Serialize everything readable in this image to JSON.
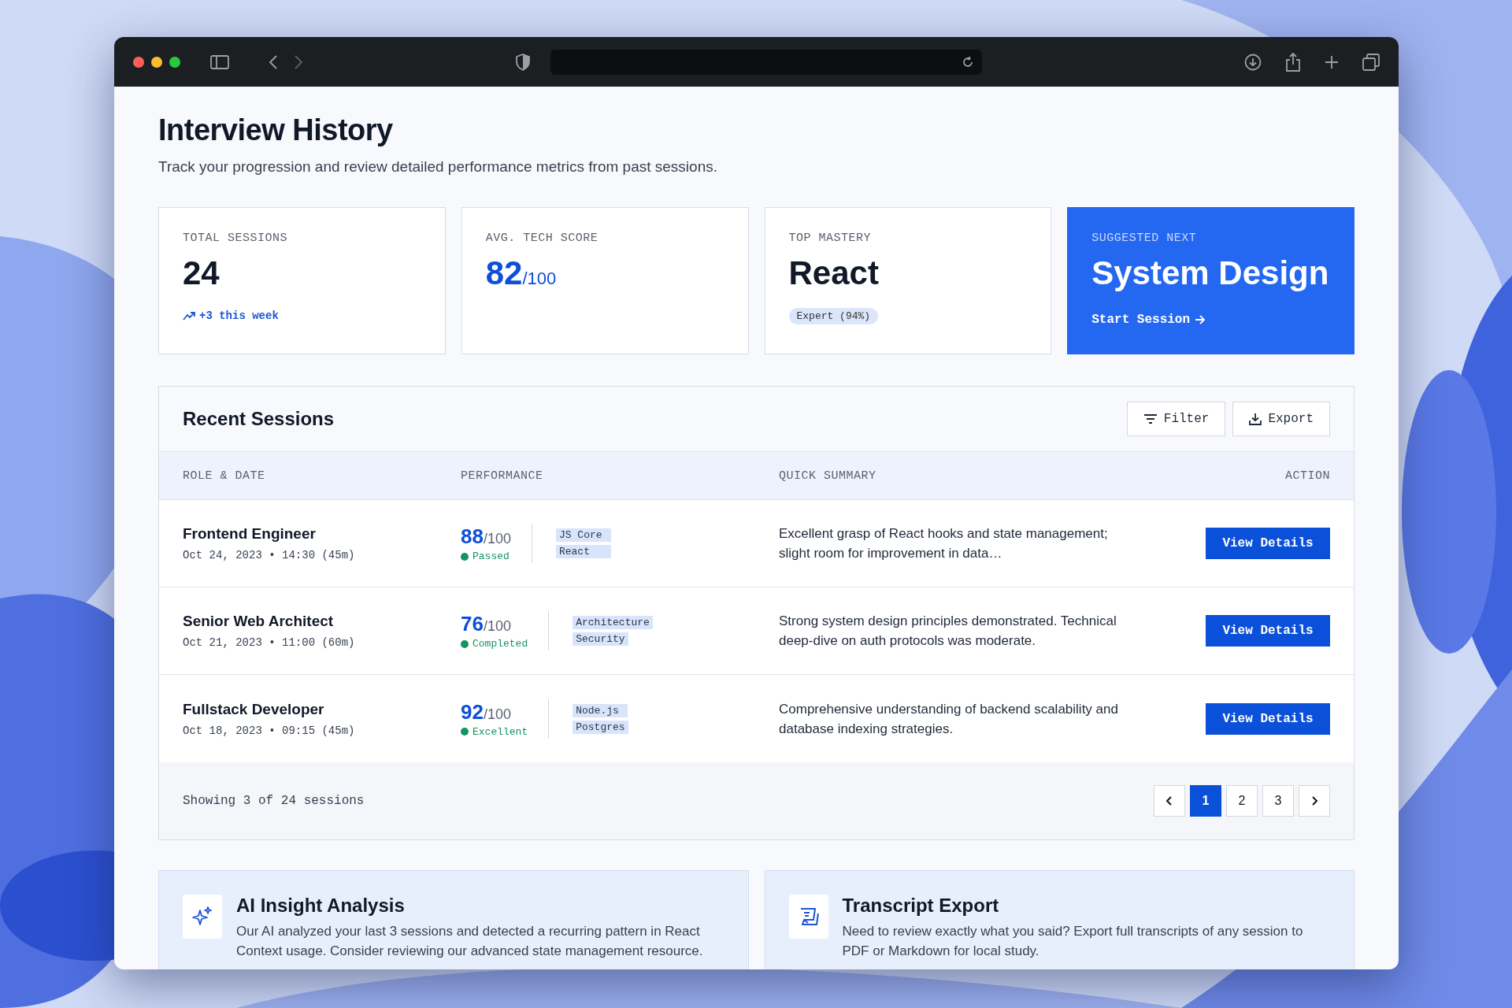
{
  "page": {
    "title": "Interview History",
    "subtitle": "Track your progression and review detailed performance metrics from past sessions."
  },
  "stats": [
    {
      "kind": "count",
      "label": "TOTAL SESSIONS",
      "value": "24",
      "trend": "+3 this week"
    },
    {
      "kind": "score",
      "label": "AVG. TECH SCORE",
      "value": "82",
      "suffix": "/100"
    },
    {
      "kind": "mastery",
      "label": "TOP MASTERY",
      "value": "React",
      "badge": "Expert (94%)"
    },
    {
      "kind": "suggested",
      "label": "SUGGESTED NEXT",
      "value": "System Design",
      "action": "Start Session"
    }
  ],
  "sessions": {
    "title": "Recent Sessions",
    "buttons": [
      {
        "kind": "filter",
        "label": "Filter"
      },
      {
        "kind": "export",
        "label": "Export"
      }
    ],
    "columns": [
      "ROLE & DATE",
      "PERFORMANCE",
      "QUICK SUMMARY",
      "ACTION"
    ],
    "rows": [
      {
        "role": "Frontend Engineer",
        "date": "Oct 24, 2023 • 14:30 (45m)",
        "score": "88",
        "out_of": "/100",
        "status": "Passed",
        "tags": [
          "JS Core",
          "React"
        ],
        "summary": "Excellent grasp of React hooks and state management; slight room for improvement in data…",
        "action": "View Details"
      },
      {
        "role": "Senior Web Architect",
        "date": "Oct 21, 2023 • 11:00 (60m)",
        "score": "76",
        "out_of": "/100",
        "status": "Completed",
        "tags": [
          "Architecture",
          "Security"
        ],
        "summary": "Strong system design principles demonstrated. Technical deep-dive on auth protocols was moderate.",
        "action": "View Details"
      },
      {
        "role": "Fullstack Developer",
        "date": "Oct 18, 2023 • 09:15 (45m)",
        "score": "92",
        "out_of": "/100",
        "status": "Excellent",
        "tags": [
          "Node.js",
          "Postgres"
        ],
        "summary": "Comprehensive understanding of backend scalability and database indexing strategies.",
        "action": "View Details"
      }
    ],
    "footer": "Showing 3 of 24 sessions",
    "pages": [
      {
        "label": "1",
        "selected": true
      },
      {
        "label": "2",
        "selected": false
      },
      {
        "label": "3",
        "selected": false
      }
    ]
  },
  "insights": [
    {
      "kind": "sparkle",
      "title": "AI Insight Analysis",
      "text": "Our AI analyzed your last 3 sessions and detected a recurring pattern in React Context usage. Consider reviewing our advanced state management resource."
    },
    {
      "kind": "transcript",
      "title": "Transcript Export",
      "text": "Need to review exactly what you said? Export full transcripts of any session to PDF or Markdown for local study."
    }
  ]
}
